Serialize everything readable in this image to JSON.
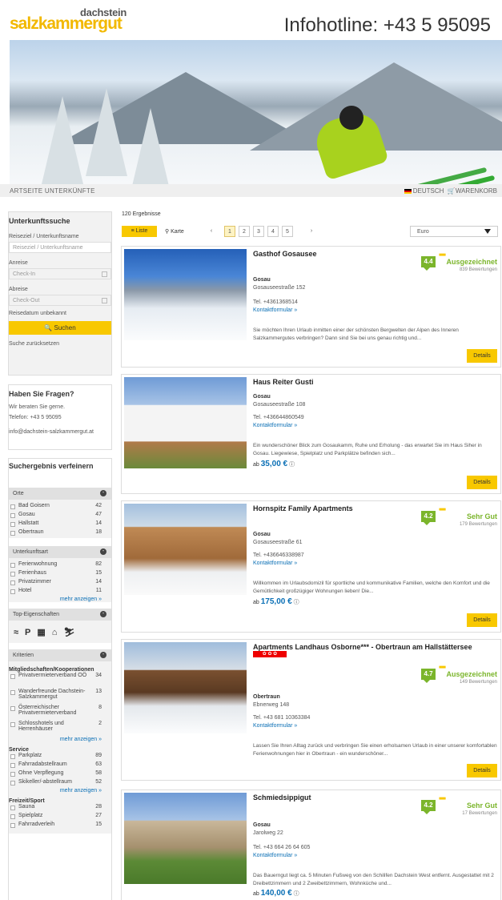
{
  "header": {
    "logo_top": "dachstein",
    "logo_main": "salzkammergut",
    "hotline": "Infohotline: +43 5 95095"
  },
  "nav": {
    "left": "ARTSEITE  UNTERKÜNFTE",
    "lang": "DEUTSCH",
    "cart": "WARENKORB"
  },
  "search": {
    "title": "Unterkunftssuche",
    "dest_label": "Reiseziel / Unterkunftsname",
    "dest_placeholder": "Reiseziel / Unterkunftsname",
    "arrival_label": "Anreise",
    "checkin": "Check-In",
    "departure_label": "Abreise",
    "checkout": "Check-Out",
    "unknown": "Reisedatum unbekannt",
    "button": "Suchen",
    "reset": "Suche zurücksetzen"
  },
  "questions": {
    "title": "Haben Sie Fragen?",
    "l1": "Wir beraten Sie gerne.",
    "l2": "Telefon: +43 5 95095",
    "l3": "info@dachstein-salzkammergut.at"
  },
  "refine": {
    "title": "Suchergebnis verfeinern",
    "orte": {
      "title": "Orte",
      "items": [
        {
          "n": "Bad Goisern",
          "c": "42"
        },
        {
          "n": "Gosau",
          "c": "47"
        },
        {
          "n": "Hallstatt",
          "c": "14"
        },
        {
          "n": "Obertraun",
          "c": "18"
        }
      ]
    },
    "art": {
      "title": "Unterkunftsart",
      "items": [
        {
          "n": "Ferienwohnung",
          "c": "82"
        },
        {
          "n": "Ferienhaus",
          "c": "15"
        },
        {
          "n": "Privatzimmer",
          "c": "14"
        },
        {
          "n": "Hotel",
          "c": "11"
        }
      ],
      "more": "mehr anzeigen »"
    },
    "top": {
      "title": "Top-Eigenschaften"
    },
    "krit": {
      "title": "Kriterien",
      "g1": "Mitgliedschaften/Kooperationen",
      "g1items": [
        {
          "n": "Privatvermieterverband OÖ",
          "c": "34"
        },
        {
          "n": "Wanderfreunde Dachstein-Salzkammergut",
          "c": "13"
        },
        {
          "n": "Österreichischer Privatvermieterverband",
          "c": "8"
        },
        {
          "n": "Schlosshotels und Herrenhäuser",
          "c": "2"
        }
      ],
      "more1": "mehr anzeigen »",
      "g2": "Service",
      "g2items": [
        {
          "n": "Parkplatz",
          "c": "89"
        },
        {
          "n": "Fahrradabstellraum",
          "c": "63"
        },
        {
          "n": "Ohne Verpflegung",
          "c": "58"
        },
        {
          "n": "Skikeller/-abstellraum",
          "c": "52"
        }
      ],
      "more2": "mehr anzeigen »",
      "g3": "Freizeit/Sport",
      "g3items": [
        {
          "n": "Sauna",
          "c": "28"
        },
        {
          "n": "Spielplatz",
          "c": "27"
        },
        {
          "n": "Fahrradverleih",
          "c": "15"
        }
      ]
    }
  },
  "results": {
    "count": "120 Ergebnisse",
    "list": "Liste",
    "map": "Karte",
    "pages": [
      "1",
      "2",
      "3",
      "4",
      "5"
    ],
    "prev": "‹",
    "next": "›",
    "currency": "Euro"
  },
  "cards": [
    {
      "name": "Gasthof Gosausee",
      "town": "Gosau",
      "addr": "Gosauseestraße 152",
      "tel": "Tel. +4361368514",
      "kf": "Kontaktformular »",
      "desc": "Sie möchten Ihren Urlaub inmitten einer der schönsten Bergwelten der Alpen des Inneren Salzkammergutes verbringen? Dann sind Sie bei uns genau richtig und...",
      "price": "",
      "score": "4.4",
      "label": "Ausgezeichnet",
      "reviews": "839 Bewertungen",
      "details": "Details"
    },
    {
      "name": "Haus Reiter Gusti",
      "town": "Gosau",
      "addr": "Gosauseestraße 108",
      "tel": "Tel. +436644860549",
      "kf": "Kontaktformular »",
      "desc": "Ein wunderschöner Blick zum Gosaukamm, Ruhe und Erholung - das erwartet Sie im Haus Siher in Gosau. Liegewiese, Spielplatz und Parkplätze befinden sich...",
      "price": "35,00 €",
      "from": "ab",
      "details": "Details"
    },
    {
      "name": "Hornspitz Family Apartments",
      "town": "Gosau",
      "addr": "Gosauseestraße 61",
      "tel": "Tel. +436646338987",
      "kf": "Kontaktformular »",
      "desc": "Willkommen im Urlaubsdomizil für sportliche und kommunikative Familien, welche den Komfort und die Gemütlichkeit großzügiger Wohnungen lieben! Die...",
      "price": "175,00 €",
      "from": "ab",
      "score": "4.2",
      "label": "Sehr Gut",
      "reviews": "179 Bewertungen",
      "details": "Details"
    },
    {
      "name": "Apartments Landhaus Osborne*** - Obertraun am Hallstättersee",
      "town": "Obertraun",
      "addr": "Ebnerweg 148",
      "tel": "Tel. +43 681 10363384",
      "kf": "Kontaktformular »",
      "desc": "Lassen Sie Ihren Alltag zurück und verbringen Sie einen erholsamen Urlaub in einer unserer komfortablen Ferienwohnungen hier in Obertraun - ein wunderschöner...",
      "badge": "✿ ✿ ✿",
      "score": "4.7",
      "label": "Ausgezeichnet",
      "reviews": "149 Bewertungen",
      "details": "Details"
    },
    {
      "name": "Schmiedsippigut",
      "town": "Gosau",
      "addr": "Jarolweg 22",
      "tel": "Tel. +43 664 26 64 605",
      "kf": "Kontaktformular »",
      "desc": "Das Bauerngut liegt ca. 5 Minuten Fußweg von den Schilifen Dachstein West entfernt. Ausgestattet mit 2 Dreibettzimmern und 2 Zweibettzimmern, Wohnküche und...",
      "price": "140,00 €",
      "from": "ab",
      "score": "4.2",
      "label": "Sehr Gut",
      "reviews": "17 Bewertungen"
    }
  ]
}
